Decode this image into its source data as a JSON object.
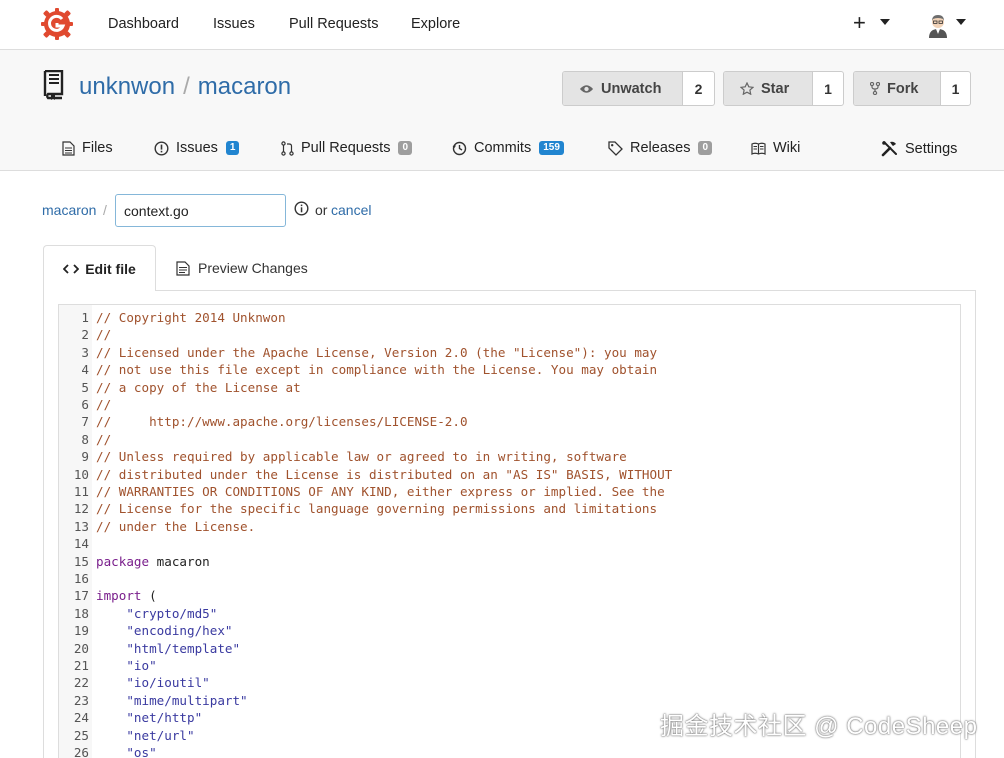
{
  "topnav": {
    "links": [
      "Dashboard",
      "Issues",
      "Pull Requests",
      "Explore"
    ],
    "plus_label": "+",
    "brand_color": "#e0492f"
  },
  "repo": {
    "owner": "unknwon",
    "separator": "/",
    "name": "macaron",
    "watch": {
      "label": "Unwatch",
      "count": "2"
    },
    "star": {
      "label": "Star",
      "count": "1"
    },
    "fork": {
      "label": "Fork",
      "count": "1"
    },
    "tabs": {
      "files": "Files",
      "issues": {
        "label": "Issues",
        "count": "1"
      },
      "pulls": {
        "label": "Pull Requests",
        "count": "0"
      },
      "commits": {
        "label": "Commits",
        "count": "159"
      },
      "releases": {
        "label": "Releases",
        "count": "0"
      },
      "wiki": "Wiki",
      "settings": "Settings"
    }
  },
  "editor_bar": {
    "breadcrumb_root": "macaron",
    "breadcrumb_sep": "/",
    "filename_value": "context.go",
    "or_text": "or",
    "cancel_label": "cancel"
  },
  "editor_tabs": {
    "edit": "Edit file",
    "preview": "Preview Changes"
  },
  "code_lines": [
    {
      "n": "1",
      "text": "// Copyright 2014 Unknwon",
      "kind": "comment"
    },
    {
      "n": "2",
      "text": "//",
      "kind": "comment"
    },
    {
      "n": "3",
      "text": "// Licensed under the Apache License, Version 2.0 (the \"License\"): you may",
      "kind": "comment"
    },
    {
      "n": "4",
      "text": "// not use this file except in compliance with the License. You may obtain",
      "kind": "comment"
    },
    {
      "n": "5",
      "text": "// a copy of the License at",
      "kind": "comment"
    },
    {
      "n": "6",
      "text": "//",
      "kind": "comment"
    },
    {
      "n": "7",
      "text": "//     http://www.apache.org/licenses/LICENSE-2.0",
      "kind": "comment"
    },
    {
      "n": "8",
      "text": "//",
      "kind": "comment"
    },
    {
      "n": "9",
      "text": "// Unless required by applicable law or agreed to in writing, software",
      "kind": "comment"
    },
    {
      "n": "10",
      "text": "// distributed under the License is distributed on an \"AS IS\" BASIS, WITHOUT",
      "kind": "comment"
    },
    {
      "n": "11",
      "text": "// WARRANTIES OR CONDITIONS OF ANY KIND, either express or implied. See the",
      "kind": "comment"
    },
    {
      "n": "12",
      "text": "// License for the specific language governing permissions and limitations",
      "kind": "comment"
    },
    {
      "n": "13",
      "text": "// under the License.",
      "kind": "comment"
    },
    {
      "n": "14",
      "text": "",
      "kind": "plain"
    },
    {
      "n": "15",
      "kw": "package",
      "rest": " macaron",
      "kind": "keyword"
    },
    {
      "n": "16",
      "text": "",
      "kind": "plain"
    },
    {
      "n": "17",
      "kw": "import",
      "rest": " (",
      "kind": "keyword"
    },
    {
      "n": "18",
      "text": "    \"crypto/md5\"",
      "kind": "string"
    },
    {
      "n": "19",
      "text": "    \"encoding/hex\"",
      "kind": "string"
    },
    {
      "n": "20",
      "text": "    \"html/template\"",
      "kind": "string"
    },
    {
      "n": "21",
      "text": "    \"io\"",
      "kind": "string"
    },
    {
      "n": "22",
      "text": "    \"io/ioutil\"",
      "kind": "string"
    },
    {
      "n": "23",
      "text": "    \"mime/multipart\"",
      "kind": "string"
    },
    {
      "n": "24",
      "text": "    \"net/http\"",
      "kind": "string"
    },
    {
      "n": "25",
      "text": "    \"net/url\"",
      "kind": "string"
    },
    {
      "n": "26",
      "text": "    \"os\"",
      "kind": "string"
    }
  ],
  "watermark": "掘金技术社区 @ CodeSheep"
}
